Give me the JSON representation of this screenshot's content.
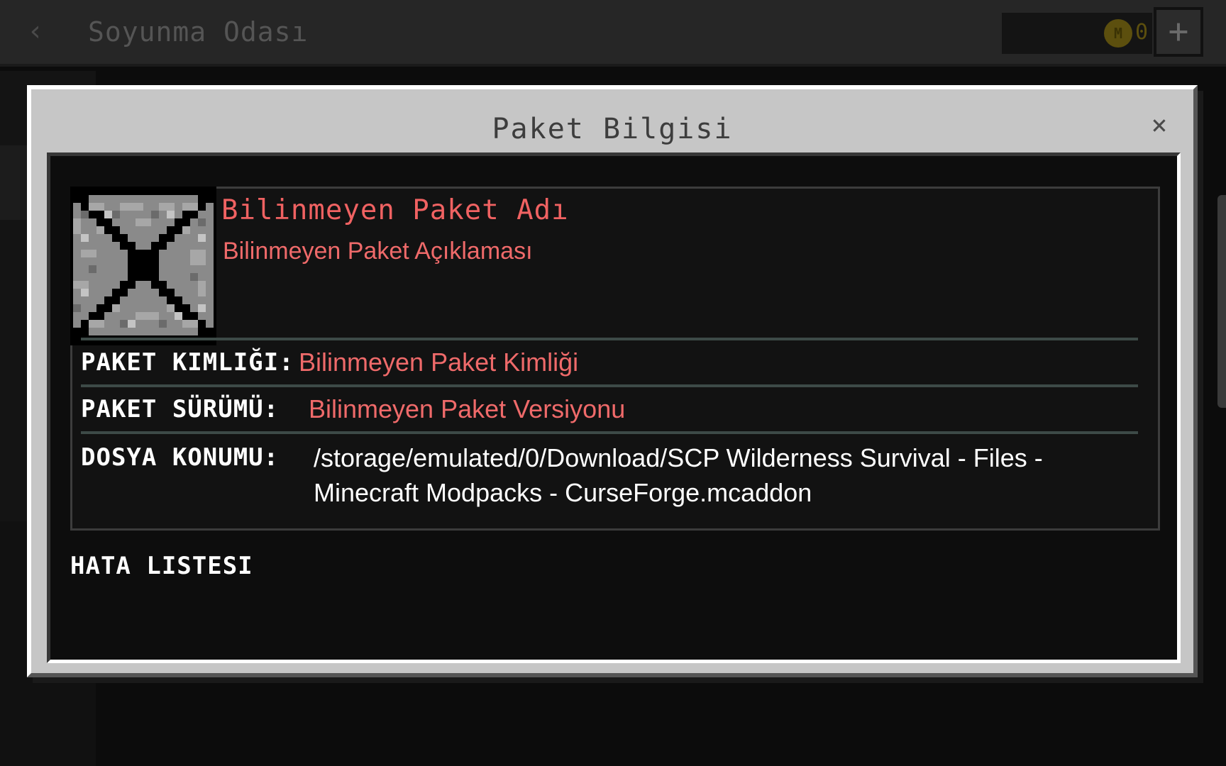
{
  "screen": {
    "title": "Soyunma Odası",
    "coin_count": "0",
    "coin_icon": "minecoin-icon",
    "back_icon": "chevron-left-icon",
    "add_icon": "plus-icon",
    "back_glyph": "‹",
    "add_glyph": "+",
    "coin_glyph": "M"
  },
  "modal": {
    "title": "Paket Bilgisi",
    "close_glyph": "×",
    "close_icon": "close-icon"
  },
  "pack": {
    "name": "Bilinmeyen Paket Adı",
    "description": "Bilinmeyen Paket Açıklaması",
    "thumbnail_icon": "unknown-pack-icon"
  },
  "details": [
    {
      "label": "PAKET KIMLIĞI:",
      "value": "Bilinmeyen Paket Kimliği"
    },
    {
      "label": "PAKET SÜRÜMÜ:",
      "value": "Bilinmeyen Paket Versiyonu"
    },
    {
      "label": "DOSYA KONUMU:",
      "value": "/storage/emulated/0/Download/SCP Wilderness Survival - Files - Minecraft Modpacks - CurseForge.mcaddon"
    }
  ],
  "errors": {
    "title": "HATA LISTESI"
  },
  "colors": {
    "error_red": "#ef6a6a",
    "panel_gray": "#c6c6c6",
    "body_dark": "#0d0d0d"
  }
}
